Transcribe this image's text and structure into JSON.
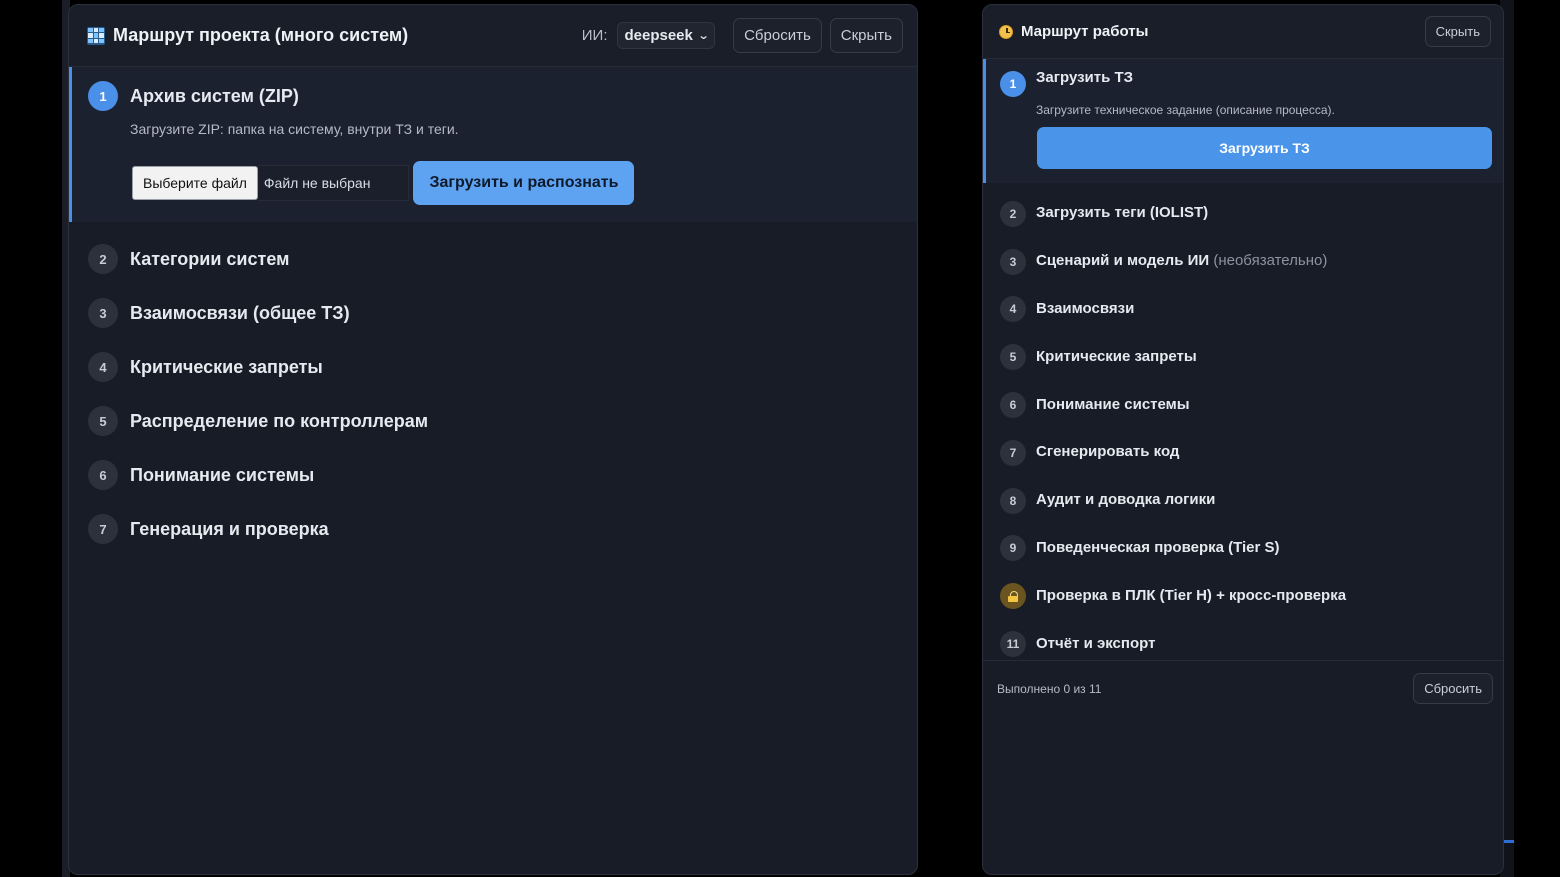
{
  "left_panel": {
    "title": "Маршрут проекта (много систем)",
    "ai_label": "ИИ:",
    "ai_model": "deepseek",
    "reset_label": "Сбросить",
    "hide_label": "Скрыть",
    "active_step": {
      "number": "1",
      "label": "Архив систем (ZIP)",
      "description": "Загрузите ZIP: папка на систему, внутри ТЗ и теги.",
      "file_button": "Выберите файл",
      "file_status": "Файл не выбран",
      "upload_button": "Загрузить и распознать"
    },
    "steps": [
      {
        "number": "2",
        "label": "Категории систем"
      },
      {
        "number": "3",
        "label": "Взаимосвязи (общее ТЗ)"
      },
      {
        "number": "4",
        "label": "Критические запреты"
      },
      {
        "number": "5",
        "label": "Распределение по контроллерам"
      },
      {
        "number": "6",
        "label": "Понимание системы"
      },
      {
        "number": "7",
        "label": "Генерация и проверка"
      }
    ]
  },
  "right_panel": {
    "title": "Маршрут работы",
    "hide_label": "Скрыть",
    "active_step": {
      "number": "1",
      "label": "Загрузить ТЗ",
      "description": "Загрузите техническое задание (описание процесса).",
      "button": "Загрузить ТЗ"
    },
    "steps": [
      {
        "number": "2",
        "label": "Загрузить теги (IOLIST)"
      },
      {
        "number": "3",
        "label": "Сценарий и модель ИИ",
        "note": "(необязательно)"
      },
      {
        "number": "4",
        "label": "Взаимосвязи"
      },
      {
        "number": "5",
        "label": "Критические запреты"
      },
      {
        "number": "6",
        "label": "Понимание системы"
      },
      {
        "number": "7",
        "label": "Сгенерировать код"
      },
      {
        "number": "8",
        "label": "Аудит и доводка логики"
      },
      {
        "number": "9",
        "label": "Поведенческая проверка (Tier S)"
      },
      {
        "icon": "lock-icon",
        "label": "Проверка в ПЛК (Tier H) + кросс-проверка"
      },
      {
        "number": "11",
        "label": "Отчёт и экспорт"
      }
    ],
    "footer": {
      "progress_text": "Выполнено 0 из 11",
      "reset_label": "Сбросить"
    }
  },
  "colors": {
    "accent": "#4a8fe8",
    "panel_bg": "#181c26",
    "primary_button": "#5ea3f2"
  }
}
